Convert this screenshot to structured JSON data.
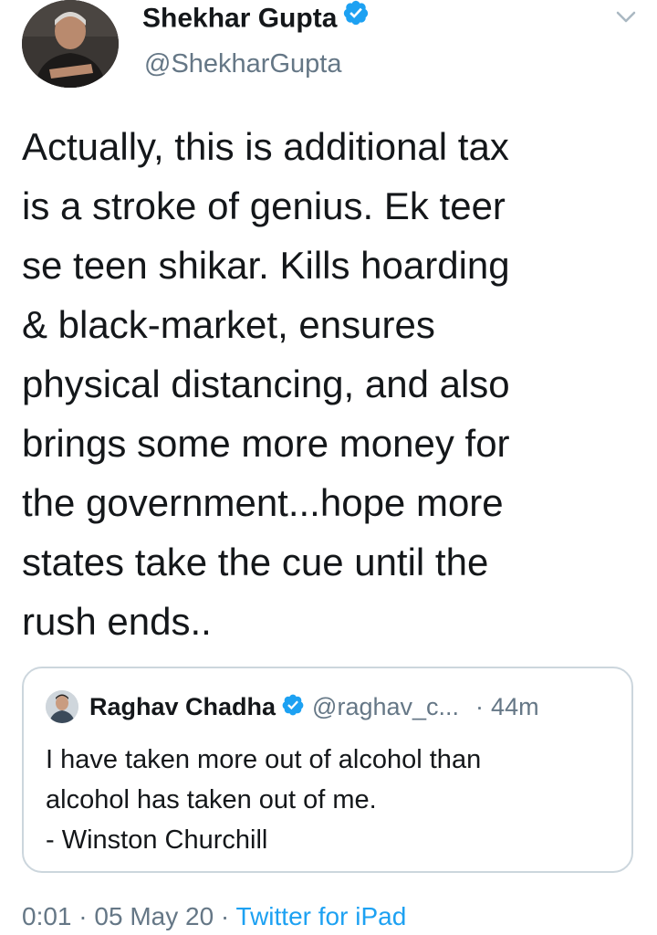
{
  "author": {
    "name": "Shekhar Gupta",
    "handle": "@ShekharGupta",
    "verified_icon": "verified-badge-icon"
  },
  "menu_icon": "chevron-down-icon",
  "tweet": {
    "text": "Actually, this is additional tax\nis a stroke of genius. Ek teer\nse teen shikar. Kills hoarding\n& black-market, ensures\nphysical distancing, and also\nbrings some more money for\nthe government...hope more\nstates take the cue until the\nrush ends.."
  },
  "quoted_tweet": {
    "name": "Raghav Chadha",
    "handle": "@raghav_c...",
    "separator": "·",
    "time": "44m",
    "text": "I have taken more out of alcohol than\nalcohol has taken out of me.\n- Winston Churchill"
  },
  "meta": {
    "time": "0:01",
    "sep1": "·",
    "date": "05 May 20",
    "sep2": "·",
    "source": "Twitter for iPad"
  },
  "colors": {
    "text": "#14171a",
    "secondary": "#657786",
    "accent": "#1da1f2",
    "border": "#ccd6dd"
  }
}
